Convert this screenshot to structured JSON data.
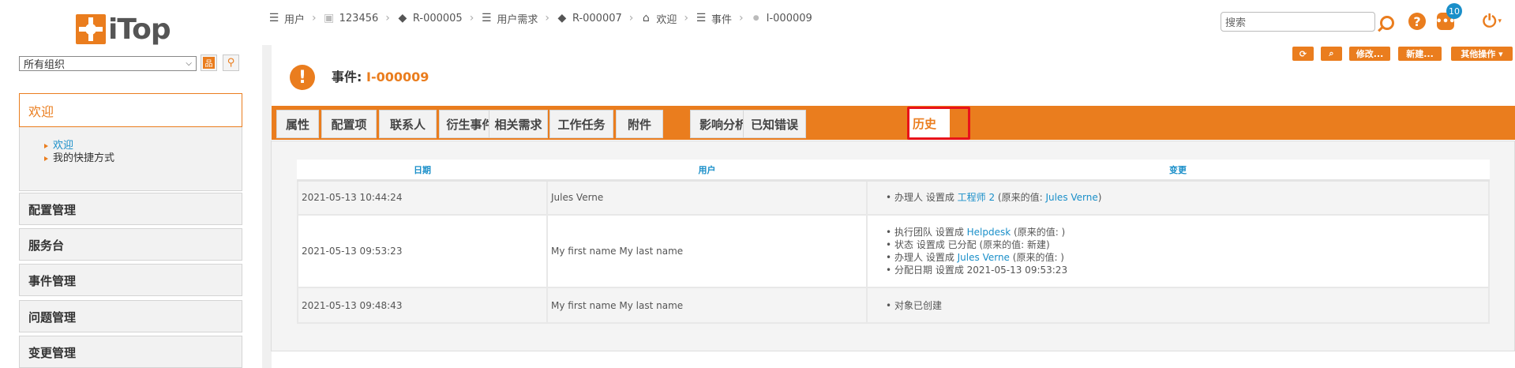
{
  "app": {
    "name": "iTop"
  },
  "org_select": {
    "value": "所有组织"
  },
  "menu": {
    "welcome": {
      "title": "欢迎",
      "items": [
        {
          "label": "欢迎",
          "active": true
        },
        {
          "label": "我的快捷方式",
          "active": false
        }
      ]
    },
    "groups": [
      "配置管理",
      "服务台",
      "事件管理",
      "问题管理",
      "变更管理"
    ]
  },
  "breadcrumb": [
    {
      "label": "用户",
      "icon": "list-icon"
    },
    {
      "label": "123456",
      "icon": "user-card-icon"
    },
    {
      "label": "R-000005",
      "icon": "diamond-icon"
    },
    {
      "label": "用户需求",
      "icon": "list-icon"
    },
    {
      "label": "R-000007",
      "icon": "diamond-icon"
    },
    {
      "label": "欢迎",
      "icon": "home-icon"
    },
    {
      "label": "事件",
      "icon": "list-icon"
    },
    {
      "label": "I-000009",
      "icon": "incident-icon"
    }
  ],
  "search": {
    "placeholder": "搜索"
  },
  "notifications": {
    "count": "10"
  },
  "actions": {
    "refresh": "⟳",
    "search": "⌕",
    "modify": "修改...",
    "new": "新建...",
    "other": "其他操作 ▾"
  },
  "object": {
    "type_label": "事件:",
    "ref": "I-000009"
  },
  "tabs": [
    "属性",
    "配置项",
    "联系人",
    "衍生事件",
    "相关需求",
    "工作任务",
    "附件",
    "影响分析",
    "已知错误",
    "历史"
  ],
  "active_tab": "历史",
  "history": {
    "headers": [
      "日期",
      "用户",
      "变更"
    ],
    "rows": [
      {
        "date": "2021-05-13 10:44:24",
        "user": "Jules Verne",
        "changes": [
          {
            "pre": "办理人 设置成 ",
            "link": "工程师 2",
            "mid": " (原来的值: ",
            "link2": "Jules Verne",
            "post": ")"
          }
        ]
      },
      {
        "date": "2021-05-13 09:53:23",
        "user": "My first name My last name",
        "changes": [
          {
            "pre": "执行团队 设置成 ",
            "link": "Helpdesk",
            "post": " (原来的值: )"
          },
          {
            "pre": "状态 设置成 已分配 (原来的值: 新建)"
          },
          {
            "pre": "办理人 设置成 ",
            "link": "Jules Verne",
            "post": " (原来的值: )"
          },
          {
            "pre": "分配日期 设置成 2021-05-13 09:53:23"
          }
        ]
      },
      {
        "date": "2021-05-13 09:48:43",
        "user": "My first name My last name",
        "changes": [
          {
            "pre": "对象已创建"
          }
        ]
      }
    ]
  },
  "colors": {
    "accent": "#ea7d1e",
    "link": "#1a8fc9",
    "highlight": "#e8131a"
  }
}
